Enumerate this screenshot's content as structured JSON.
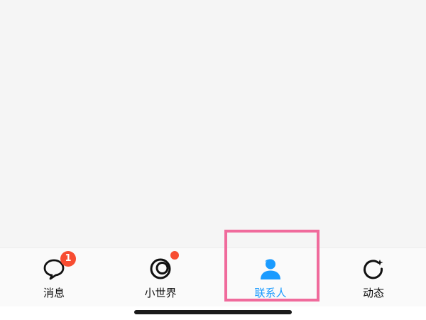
{
  "tabbar": {
    "tabs": [
      {
        "label": "消息",
        "icon": "chat-bubble-icon",
        "badge": "1"
      },
      {
        "label": "小世界",
        "icon": "world-ring-icon",
        "badge_dot": true
      },
      {
        "label": "联系人",
        "icon": "contact-person-icon",
        "active": true
      },
      {
        "label": "动态",
        "icon": "feed-refresh-icon"
      }
    ]
  },
  "colors": {
    "active": "#1a9bff",
    "badge": "#f74c31",
    "highlight": "#f06b9c",
    "content_bg": "#f5f5f5"
  }
}
